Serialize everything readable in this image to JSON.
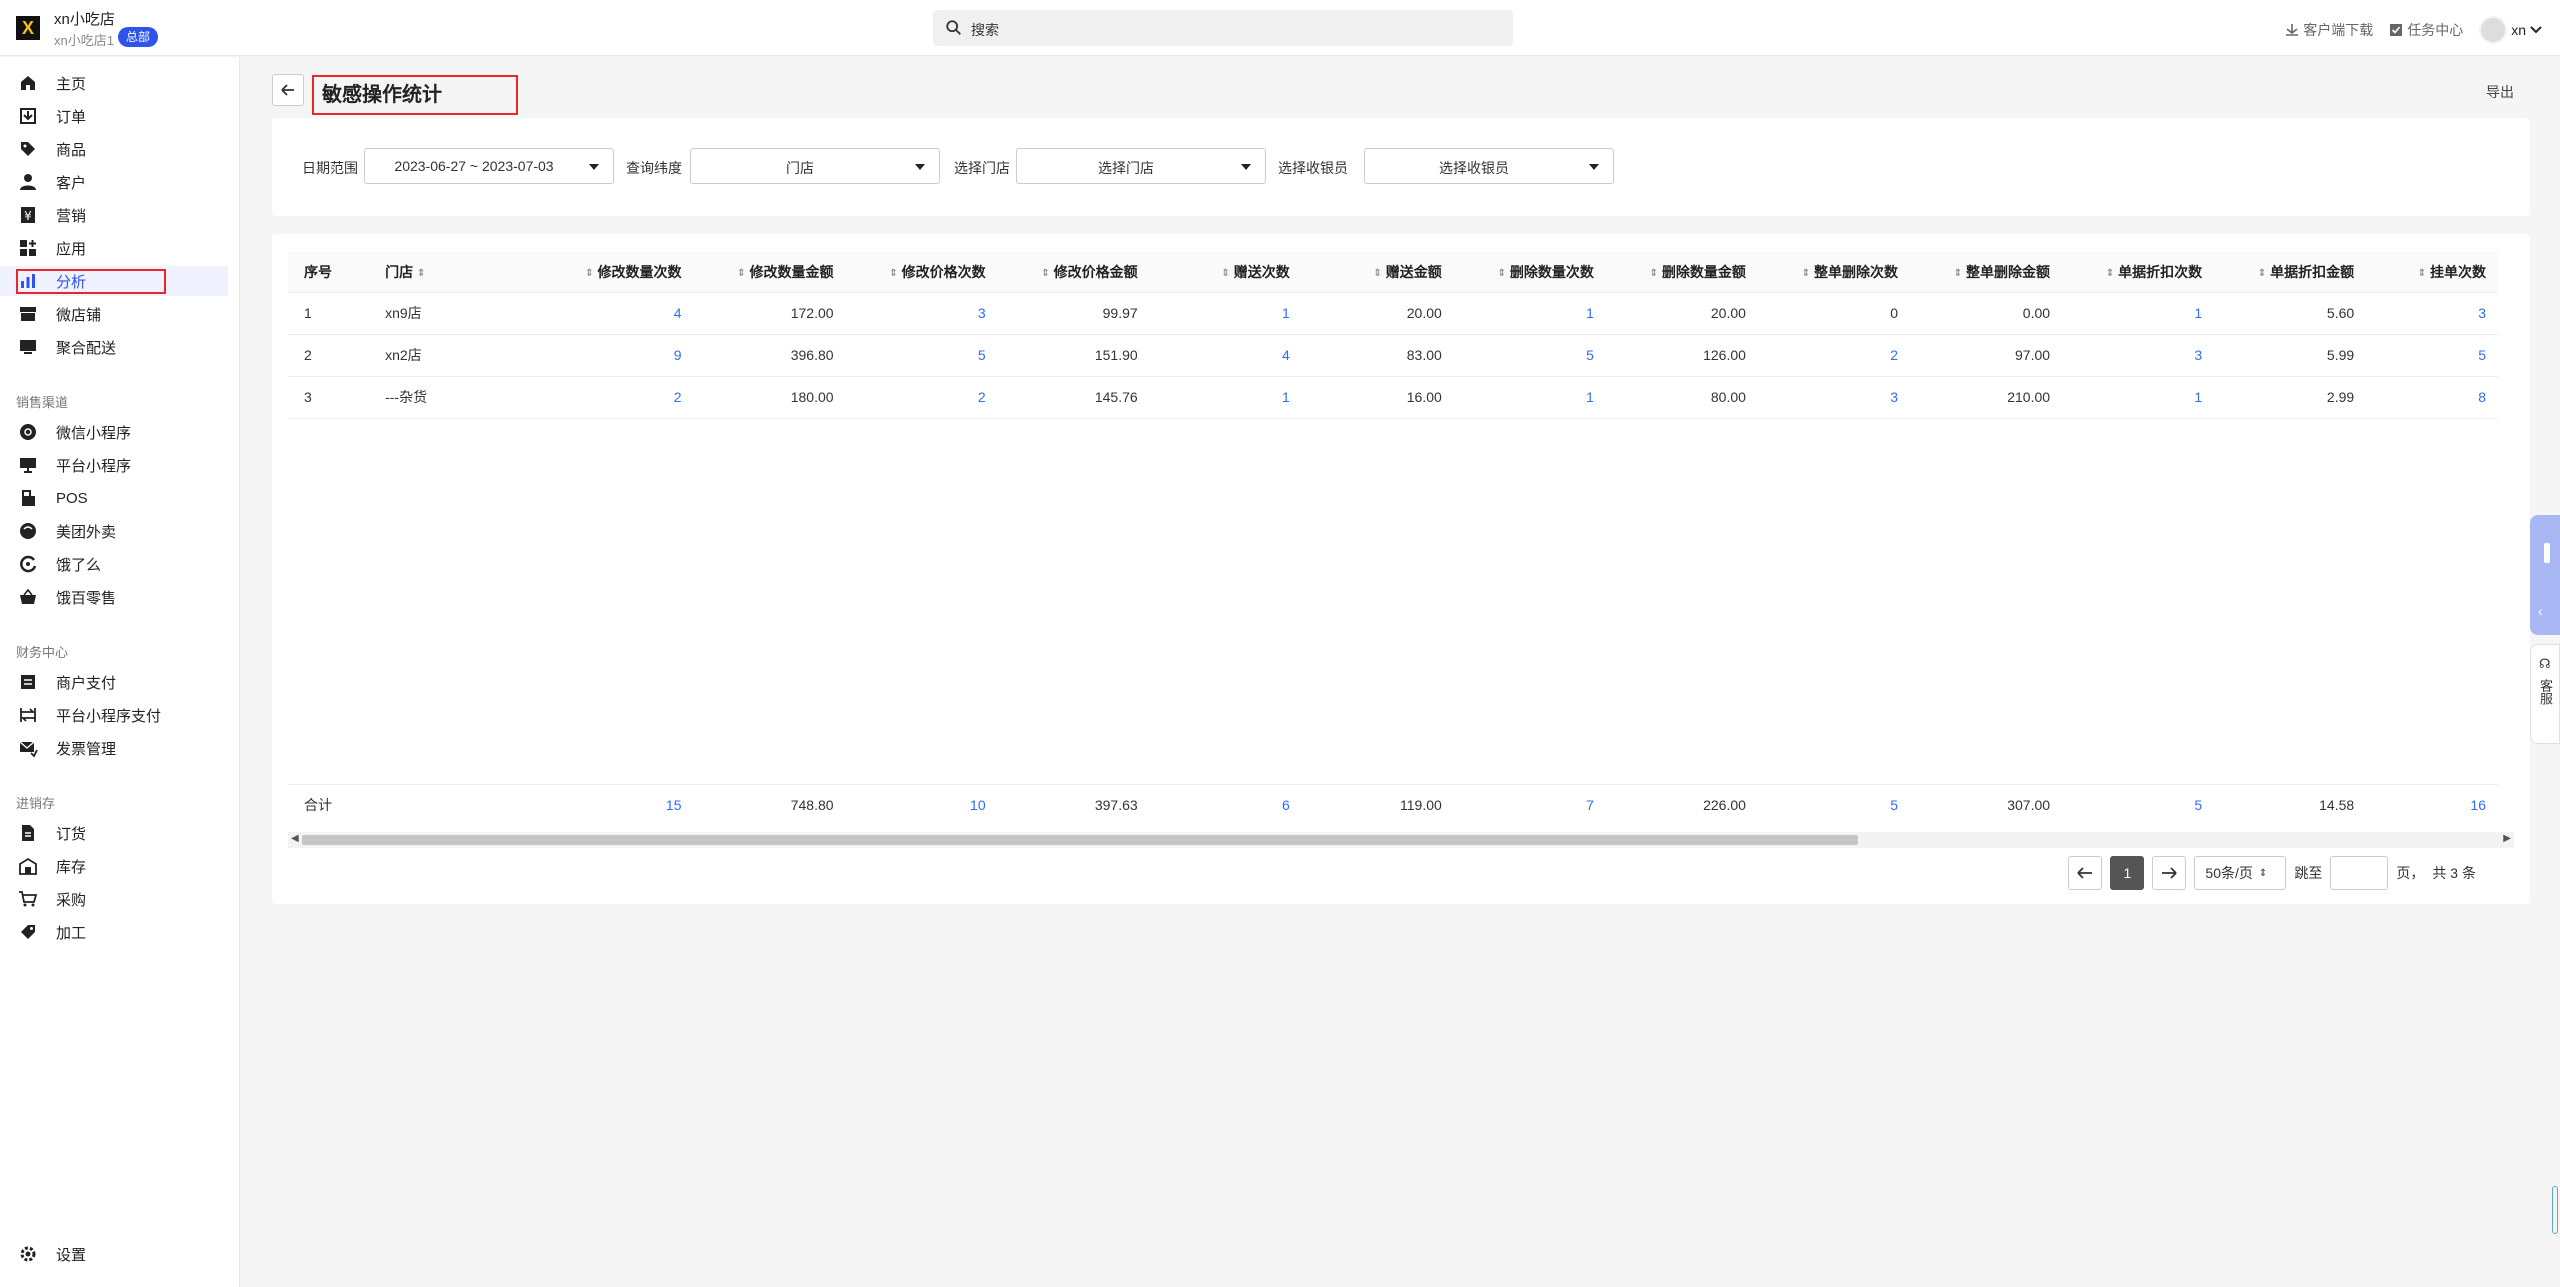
{
  "app": {
    "store_name": "xn小吃店",
    "store_sub": "xn小吃店1",
    "store_badge": "总部",
    "search_placeholder": "搜索",
    "download_label": "客户端下载",
    "tasks_label": "任务中心",
    "username": "xn"
  },
  "sidebar": {
    "items": [
      {
        "label": "主页",
        "icon": "home-icon"
      },
      {
        "label": "订单",
        "icon": "download-box-icon"
      },
      {
        "label": "商品",
        "icon": "tag-icon"
      },
      {
        "label": "客户",
        "icon": "user-icon"
      },
      {
        "label": "营销",
        "icon": "yen-icon"
      },
      {
        "label": "应用",
        "icon": "apps-grid-icon"
      },
      {
        "label": "分析",
        "icon": "bar-chart-icon"
      },
      {
        "label": "微店铺",
        "icon": "store-icon"
      },
      {
        "label": "聚合配送",
        "icon": "monitor-icon"
      }
    ],
    "section_sales": "销售渠道",
    "sales_items": [
      {
        "label": "微信小程序",
        "icon": "mini-program-icon"
      },
      {
        "label": "平台小程序",
        "icon": "platform-icon"
      },
      {
        "label": "POS",
        "icon": "pos-icon"
      },
      {
        "label": "美团外卖",
        "icon": "meituan-icon"
      },
      {
        "label": "饿了么",
        "icon": "eleme-icon"
      },
      {
        "label": "饿百零售",
        "icon": "basket-icon"
      }
    ],
    "section_finance": "财务中心",
    "finance_items": [
      {
        "label": "商户支付",
        "icon": "list-icon"
      },
      {
        "label": "平台小程序支付",
        "icon": "transfer-icon"
      },
      {
        "label": "发票管理",
        "icon": "invoice-icon"
      }
    ],
    "section_inventory": "进销存",
    "inventory_items": [
      {
        "label": "订货",
        "icon": "document-icon"
      },
      {
        "label": "库存",
        "icon": "warehouse-icon"
      },
      {
        "label": "采购",
        "icon": "cart-icon"
      },
      {
        "label": "加工",
        "icon": "process-icon"
      }
    ],
    "settings_label": "设置"
  },
  "page": {
    "title": "敏感操作统计",
    "export_label": "导出"
  },
  "filters": {
    "date_label": "日期范围",
    "date_value": "2023-06-27 ~ 2023-07-03",
    "dimension_label": "查询纬度",
    "dimension_value": "门店",
    "store_label": "选择门店",
    "store_value": "选择门店",
    "cashier_label": "选择收银员",
    "cashier_value": "选择收银员"
  },
  "table": {
    "headers": [
      "序号",
      "门店",
      "修改数量次数",
      "修改数量金额",
      "修改价格次数",
      "修改价格金额",
      "赠送次数",
      "赠送金额",
      "删除数量次数",
      "删除数量金额",
      "整单删除次数",
      "整单删除金额",
      "单据折扣次数",
      "单据折扣金额",
      "挂单次数"
    ],
    "rows": [
      [
        "1",
        "xn9店",
        "4",
        "172.00",
        "3",
        "99.97",
        "1",
        "20.00",
        "1",
        "20.00",
        "0",
        "0.00",
        "1",
        "5.60",
        "3"
      ],
      [
        "2",
        "xn2店",
        "9",
        "396.80",
        "5",
        "151.90",
        "4",
        "83.00",
        "5",
        "126.00",
        "2",
        "97.00",
        "3",
        "5.99",
        "5"
      ],
      [
        "3",
        "---杂货",
        "2",
        "180.00",
        "2",
        "145.76",
        "1",
        "16.00",
        "1",
        "80.00",
        "3",
        "210.00",
        "1",
        "2.99",
        "8"
      ]
    ],
    "total": [
      "合计",
      "",
      "15",
      "748.80",
      "10",
      "397.63",
      "6",
      "119.00",
      "7",
      "226.00",
      "5",
      "307.00",
      "5",
      "14.58",
      "16"
    ]
  },
  "pager": {
    "current": "1",
    "page_size": "50条/页",
    "jump_prefix": "跳至",
    "jump_suffix": "页，",
    "total": "共 3 条"
  },
  "float": {
    "service_label": "客服"
  },
  "colors": {
    "accent": "#2f54eb",
    "link": "#2f6fed",
    "highlight": "#e8262b"
  }
}
